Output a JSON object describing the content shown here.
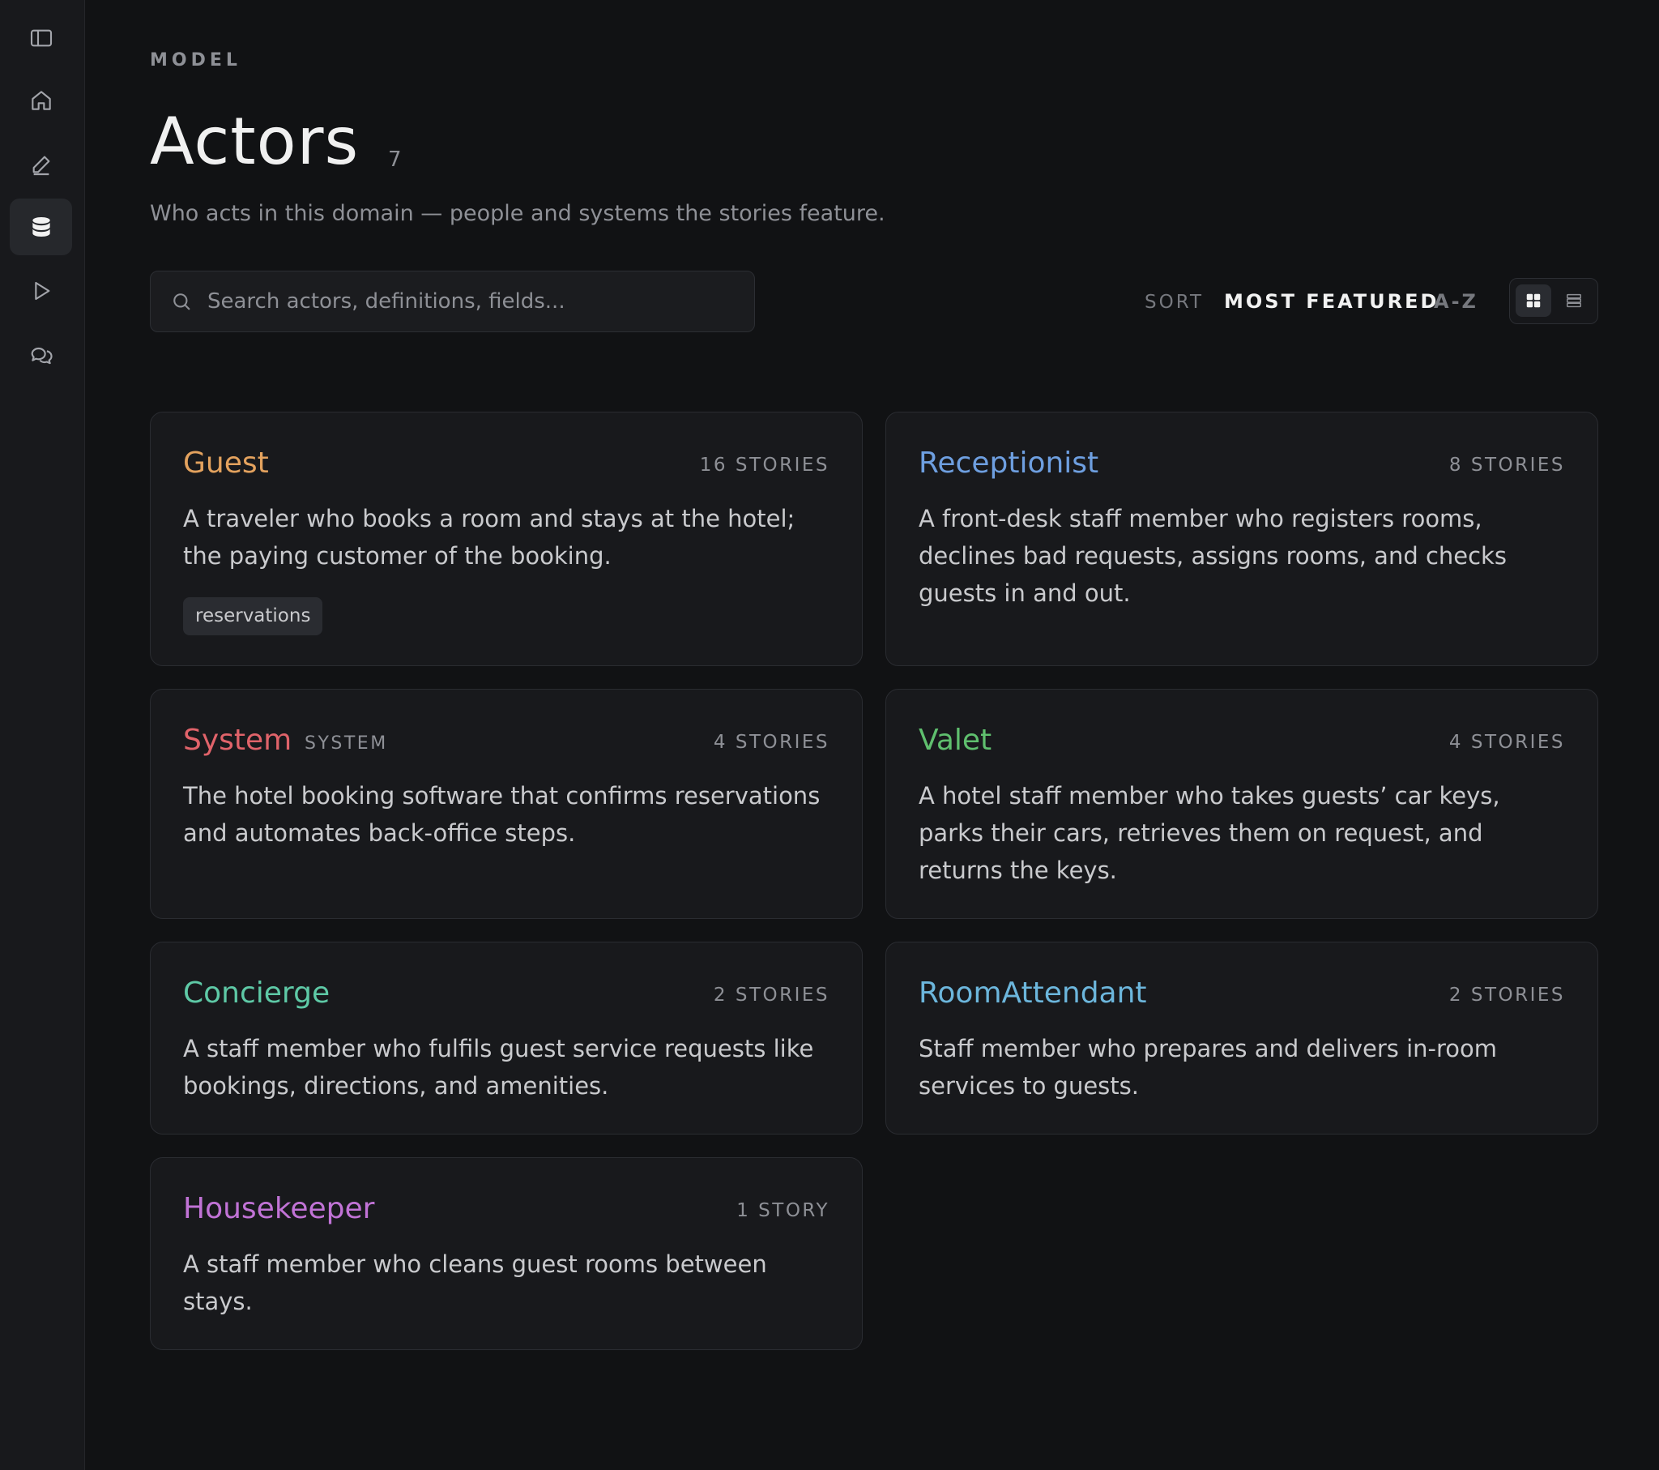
{
  "sidebar": {
    "items": [
      {
        "icon": "sidebar-toggle-icon"
      },
      {
        "icon": "home-icon"
      },
      {
        "icon": "pencil-icon"
      },
      {
        "icon": "database-icon",
        "active": true
      },
      {
        "icon": "play-icon"
      },
      {
        "icon": "chat-icon"
      }
    ]
  },
  "header": {
    "eyebrow": "MODEL",
    "title": "Actors",
    "count": "7",
    "subtitle": "Who acts in this domain — people and systems the stories feature."
  },
  "search": {
    "placeholder": "Search actors, definitions, fields..."
  },
  "sort": {
    "label": "SORT",
    "options": [
      "MOST FEATURED",
      "A-Z"
    ],
    "selected": "MOST FEATURED"
  },
  "view": {
    "selected": "grid"
  },
  "actors": [
    {
      "name": "Guest",
      "color": "#e3a25e",
      "stories": "16 STORIES",
      "description": "A traveler who books a room and stays at the hotel; the paying customer of the booking.",
      "tag": "reservations"
    },
    {
      "name": "Receptionist",
      "color": "#6e9fe0",
      "stories": "8 STORIES",
      "description": "A front-desk staff member who registers rooms, declines bad requests, assigns rooms, and checks guests in and out."
    },
    {
      "name": "System",
      "type": "SYSTEM",
      "color": "#e0636a",
      "stories": "4 STORIES",
      "description": "The hotel booking software that confirms reservations and automates back-office steps."
    },
    {
      "name": "Valet",
      "color": "#5fbf6e",
      "stories": "4 STORIES",
      "description": "A hotel staff member who takes guests’ car keys, parks their cars, retrieves them on request, and returns the keys."
    },
    {
      "name": "Concierge",
      "color": "#5ec9a6",
      "stories": "2 STORIES",
      "description": "A staff member who fulfils guest service requests like bookings, directions, and amenities."
    },
    {
      "name": "RoomAttendant",
      "color": "#6cb6dc",
      "stories": "2 STORIES",
      "description": "Staff member who prepares and delivers in-room services to guests."
    },
    {
      "name": "Housekeeper",
      "color": "#c173d6",
      "stories": "1 STORY",
      "description": "A staff member who cleans guest rooms between stays."
    }
  ]
}
